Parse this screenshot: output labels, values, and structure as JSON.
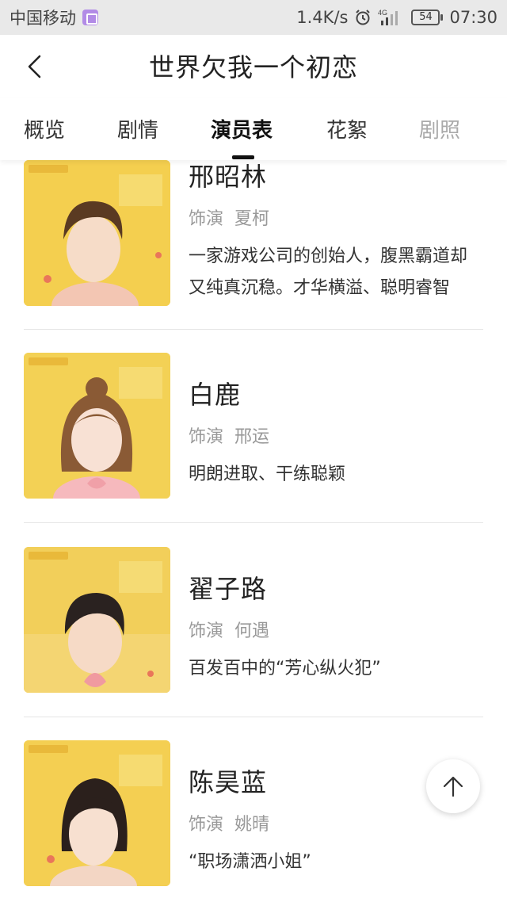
{
  "status_bar": {
    "carrier": "中国移动",
    "speed": "1.4K/s",
    "network": "4G",
    "battery": "54",
    "time": "07:30"
  },
  "header": {
    "title": "世界欠我一个初恋",
    "back_icon": "chevron-left-icon"
  },
  "tabs": [
    {
      "label": "概览",
      "active": false
    },
    {
      "label": "剧情",
      "active": false
    },
    {
      "label": "演员表",
      "active": true
    },
    {
      "label": "花絮",
      "active": false
    },
    {
      "label": "剧照",
      "active": false
    }
  ],
  "cast": [
    {
      "name": "邢昭林",
      "role_prefix": "饰演",
      "role": "夏柯",
      "desc": "一家游戏公司的创始人，腹黑霸道却又纯真沉稳。才华横溢、聪明睿智",
      "poster_bg": "#f4cf4f",
      "hair": "#5a3a22",
      "shirt": "#f3c6b3"
    },
    {
      "name": "白鹿",
      "role_prefix": "饰演",
      "role": "邢运",
      "desc": "明朗进取、干练聪颖",
      "poster_bg": "#f3d155",
      "hair": "#8a5a35",
      "shirt": "#f6b9bd"
    },
    {
      "name": "翟子路",
      "role_prefix": "饰演",
      "role": "何遇",
      "desc": "百发百中的“芳心纵火犯”",
      "poster_bg": "#f2cf5a",
      "hair": "#2a2220",
      "shirt": "#f4d7c0"
    },
    {
      "name": "陈昊蓝",
      "role_prefix": "饰演",
      "role": "姚晴",
      "desc": "“职场潇洒小姐”",
      "poster_bg": "#f4cf52",
      "hair": "#2b201c",
      "shirt": "#f3d6c4"
    }
  ],
  "scroll_top": {
    "icon": "arrow-up-icon"
  }
}
